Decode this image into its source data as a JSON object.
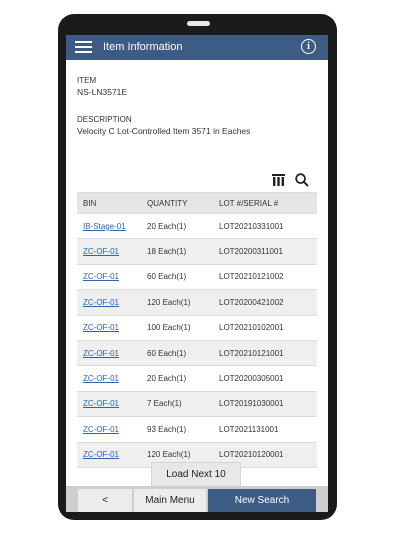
{
  "header": {
    "title": "Item Information"
  },
  "item": {
    "label": "ITEM",
    "value": "NS-LN3571E"
  },
  "description": {
    "label": "DESCRIPTION",
    "value": "Velocity C Lot-Controlled Item 3571 in Eaches"
  },
  "table": {
    "columns": [
      "BIN",
      "QUANTITY",
      "LOT #/SERIAL #"
    ],
    "rows": [
      {
        "bin": "IB-Stage-01",
        "quantity": "20 Each(1)",
        "lot": "LOT20210331001"
      },
      {
        "bin": "ZC-OF-01",
        "quantity": "18 Each(1)",
        "lot": "LOT20200311001"
      },
      {
        "bin": "ZC-OF-01",
        "quantity": "60 Each(1)",
        "lot": "LOT20210121002"
      },
      {
        "bin": "ZC-OF-01",
        "quantity": "120 Each(1)",
        "lot": "LOT20200421002"
      },
      {
        "bin": "ZC-OF-01",
        "quantity": "100 Each(1)",
        "lot": "LOT20210102001"
      },
      {
        "bin": "ZC-OF-01",
        "quantity": "60 Each(1)",
        "lot": "LOT20210121001"
      },
      {
        "bin": "ZC-OF-01",
        "quantity": "20 Each(1)",
        "lot": "LOT20200305001"
      },
      {
        "bin": "ZC-OF-01",
        "quantity": "7 Each(1)",
        "lot": "LOT20191030001"
      },
      {
        "bin": "ZC-OF-01",
        "quantity": "93 Each(1)",
        "lot": "LOT2021131001"
      },
      {
        "bin": "ZC-OF-01",
        "quantity": "120 Each(1)",
        "lot": "LOT20210120001"
      }
    ]
  },
  "load_next_label": "Load Next 10",
  "footer": {
    "back_label": "<",
    "main_menu_label": "Main Menu",
    "new_search_label": "New Search"
  },
  "colors": {
    "accent": "#3c5c86",
    "link": "#2a62b4"
  },
  "icons": {
    "menu": "hamburger-icon",
    "info": "info-icon",
    "columns": "columns-icon",
    "search": "search-icon"
  }
}
